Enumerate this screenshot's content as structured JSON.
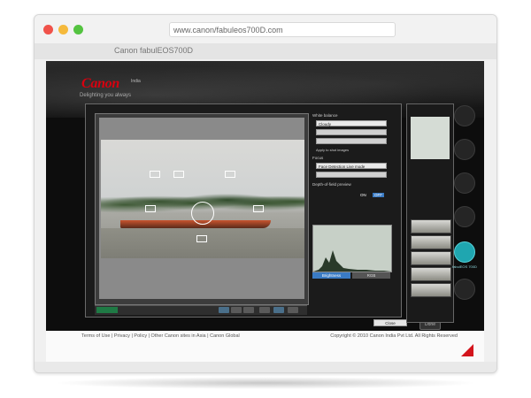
{
  "browser": {
    "url": "www.canon/fabuleos700D.com",
    "tab_title": "Canon fabulEOS700D"
  },
  "site": {
    "brand": "Canon",
    "region": "India",
    "tagline": "Delighting you always"
  },
  "app": {
    "settings": {
      "white_balance_label": "White balance",
      "white_balance_value": "Cloudy",
      "apply_label": "Apply to shot images",
      "focus_label": "Focus",
      "focus_mode": "Face Detection Live mode",
      "dof_label": "Depth-of-field preview",
      "dof_on": "ON",
      "dof_off": "OFF",
      "brightness_tab": "Brightness",
      "rgb_tab": "RGB",
      "close_button": "Close"
    },
    "done_button": "Done",
    "side_active_label": "fabulEOS 700D"
  },
  "footer": {
    "links": "Terms of Use | Privacy | Policy | Other Canon sites in Asia | Canon Global",
    "copyright": "Copyright © 2010 Canon India Pvt Ltd. All Rights Reserved"
  },
  "colors": {
    "canon_red": "#d7000f",
    "accent_teal": "#1fa6b0",
    "accent_blue": "#3a7bc4"
  }
}
